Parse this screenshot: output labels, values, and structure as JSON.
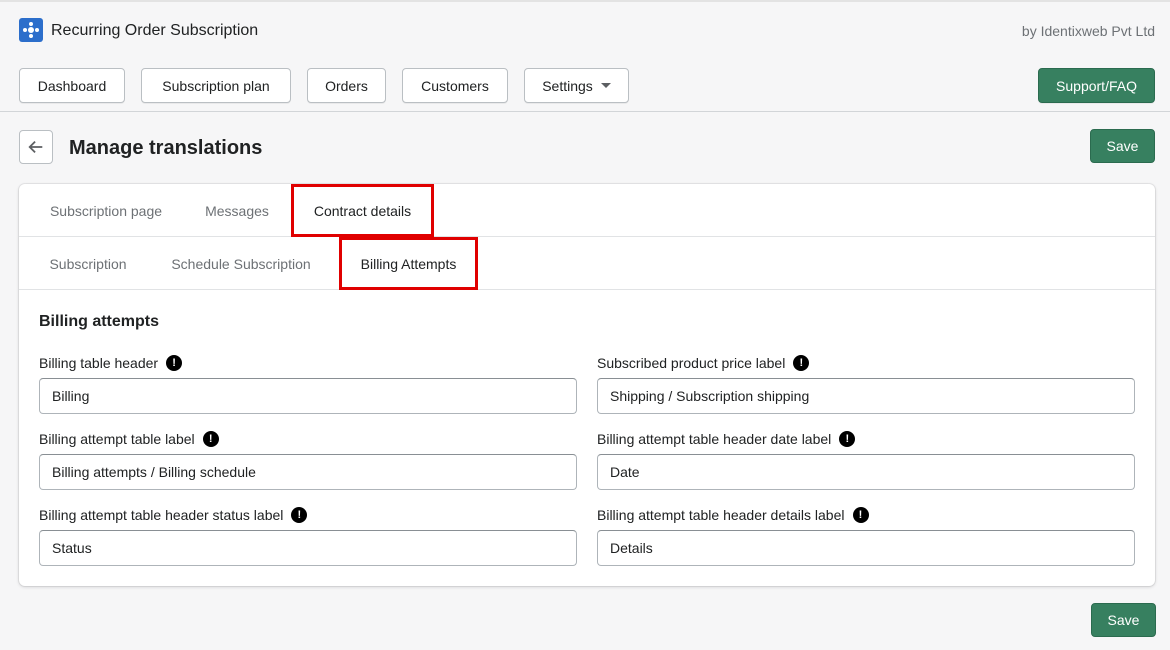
{
  "app": {
    "title": "Recurring Order Subscription",
    "byline": "by Identixweb Pvt Ltd",
    "logo_icon": "app-logo-icon"
  },
  "nav": {
    "dashboard": "Dashboard",
    "subscription_plan": "Subscription plan",
    "orders": "Orders",
    "customers": "Customers",
    "settings": "Settings",
    "support": "Support/FAQ"
  },
  "page": {
    "title": "Manage translations",
    "save_label": "Save",
    "back_icon": "arrow-left-icon"
  },
  "tabs": {
    "primary": [
      "Subscription page",
      "Messages",
      "Contract details"
    ],
    "primary_active": "Contract details",
    "secondary": [
      "Subscription",
      "Schedule Subscription",
      "Billing Attempts"
    ],
    "secondary_active": "Billing Attempts"
  },
  "section": {
    "title": "Billing attempts",
    "fields": [
      {
        "label": "Billing table header",
        "value": "Billing"
      },
      {
        "label": "Subscribed product price label",
        "value": "Shipping / Subscription shipping"
      },
      {
        "label": "Billing attempt table label",
        "value": "Billing attempts / Billing schedule"
      },
      {
        "label": "Billing attempt table header date label",
        "value": "Date"
      },
      {
        "label": "Billing attempt table header status label",
        "value": "Status"
      },
      {
        "label": "Billing attempt table header details label",
        "value": "Details"
      }
    ]
  },
  "colors": {
    "primary_green": "#378060",
    "highlight_red": "#e00000",
    "background": "#f6f6f7"
  }
}
